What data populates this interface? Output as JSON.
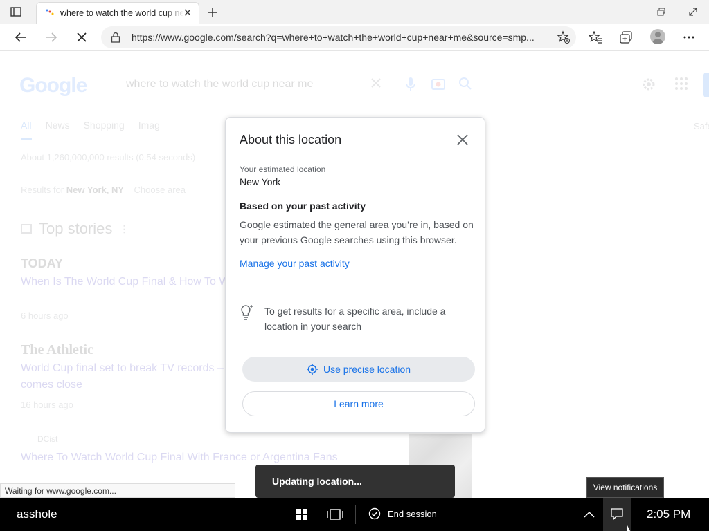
{
  "browser": {
    "tab_title": "where to watch the world cup near me",
    "url": "https://www.google.com/search?q=where+to+watch+the+world+cup+near+me&source=smp...",
    "status_text": "Waiting for www.google.com..."
  },
  "page": {
    "logo": "Google",
    "search_query": "where to watch the world cup near me",
    "tabs": [
      "All",
      "News",
      "Shopping",
      "Imag"
    ],
    "safe_label": "Safe",
    "results_count": "About 1,260,000,000 results (0.54 seconds)",
    "results_for_prefix": "Results for",
    "results_for_location": "New York, NY",
    "choose_area": "Choose area",
    "top_stories": "Top stories",
    "stories": [
      {
        "source": "TODAY",
        "headline": "When Is The World Cup Final & How To W",
        "time": "6 hours ago"
      },
      {
        "source": "The Athletic",
        "headline": "World Cup final set to break TV records –",
        "headline2": "comes close",
        "time": "16 hours ago"
      },
      {
        "source": "DCist",
        "headline": "Where To Watch World Cup Final With France or Argentina Fans"
      }
    ]
  },
  "dialog": {
    "title": "About this location",
    "estimated_label": "Your estimated location",
    "estimated_value": "New York",
    "heading": "Based on your past activity",
    "body": "Google estimated the general area you’re in, based on your previous Google searches using this browser.",
    "link": "Manage your past activity",
    "tip": "To get results for a specific area, include a location in your search",
    "precise_button": "Use precise location",
    "learn_button": "Learn more"
  },
  "toast": "Updating location...",
  "tooltip": "View notifications",
  "taskbar": {
    "user": "asshole",
    "end_session": "End session",
    "clock": "2:05 PM"
  },
  "colors": {
    "accent": "#1a73e8",
    "taskbar": "#000000",
    "toast": "#323232"
  }
}
